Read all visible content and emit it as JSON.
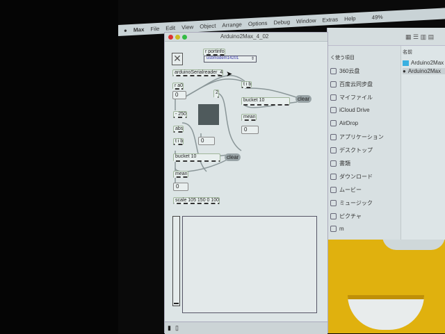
{
  "menubar": {
    "items": [
      "Max",
      "File",
      "Edit",
      "View",
      "Object",
      "Arrange",
      "Options",
      "Debug",
      "Window",
      "Extras",
      "Help"
    ],
    "battery": "49%"
  },
  "max_window": {
    "title": "Arduino2Max_4_02",
    "objects": {
      "portinfo": "r portinfo",
      "port_menu": "usbmodem14201",
      "reader": "arduinoSerialreader_4",
      "ra0": "r a0",
      "num_a0": "0",
      "two": "2",
      "minus": "- 250",
      "abs": "abs",
      "tib_left": "t i b",
      "num_slider": "0",
      "bucket_left": "bucket 10",
      "clear_left": "clear",
      "mean_left": "mean",
      "num_mean_left": "0",
      "scale": "scale 105 150 0 100",
      "tib_right": "t i b",
      "bucket_right": "bucket 10",
      "clear_right": "clear",
      "mean_right": "mean",
      "num_mean_right": "0"
    },
    "slider_value": 0
  },
  "finder": {
    "sidebar_header": "く使う項目",
    "sidebar": [
      {
        "label": "360云盘",
        "icon": "folder-icon"
      },
      {
        "label": "百度云同步盘",
        "icon": "folder-icon"
      },
      {
        "label": "マイファイル",
        "icon": "files-icon"
      },
      {
        "label": "iCloud Drive",
        "icon": "cloud-icon"
      },
      {
        "label": "AirDrop",
        "icon": "airdrop-icon"
      },
      {
        "label": "アプリケーション",
        "icon": "apps-icon"
      },
      {
        "label": "デスクトップ",
        "icon": "desktop-icon"
      },
      {
        "label": "書類",
        "icon": "document-icon"
      },
      {
        "label": "ダウンロード",
        "icon": "download-icon"
      },
      {
        "label": "ムービー",
        "icon": "movie-icon"
      },
      {
        "label": "ミュージック",
        "icon": "music-icon"
      },
      {
        "label": "ピクチャ",
        "icon": "camera-icon"
      },
      {
        "label": "m",
        "icon": "home-icon"
      }
    ],
    "column_header": "名前",
    "files": [
      "Arduino2Max",
      "Arduino2Max"
    ]
  }
}
